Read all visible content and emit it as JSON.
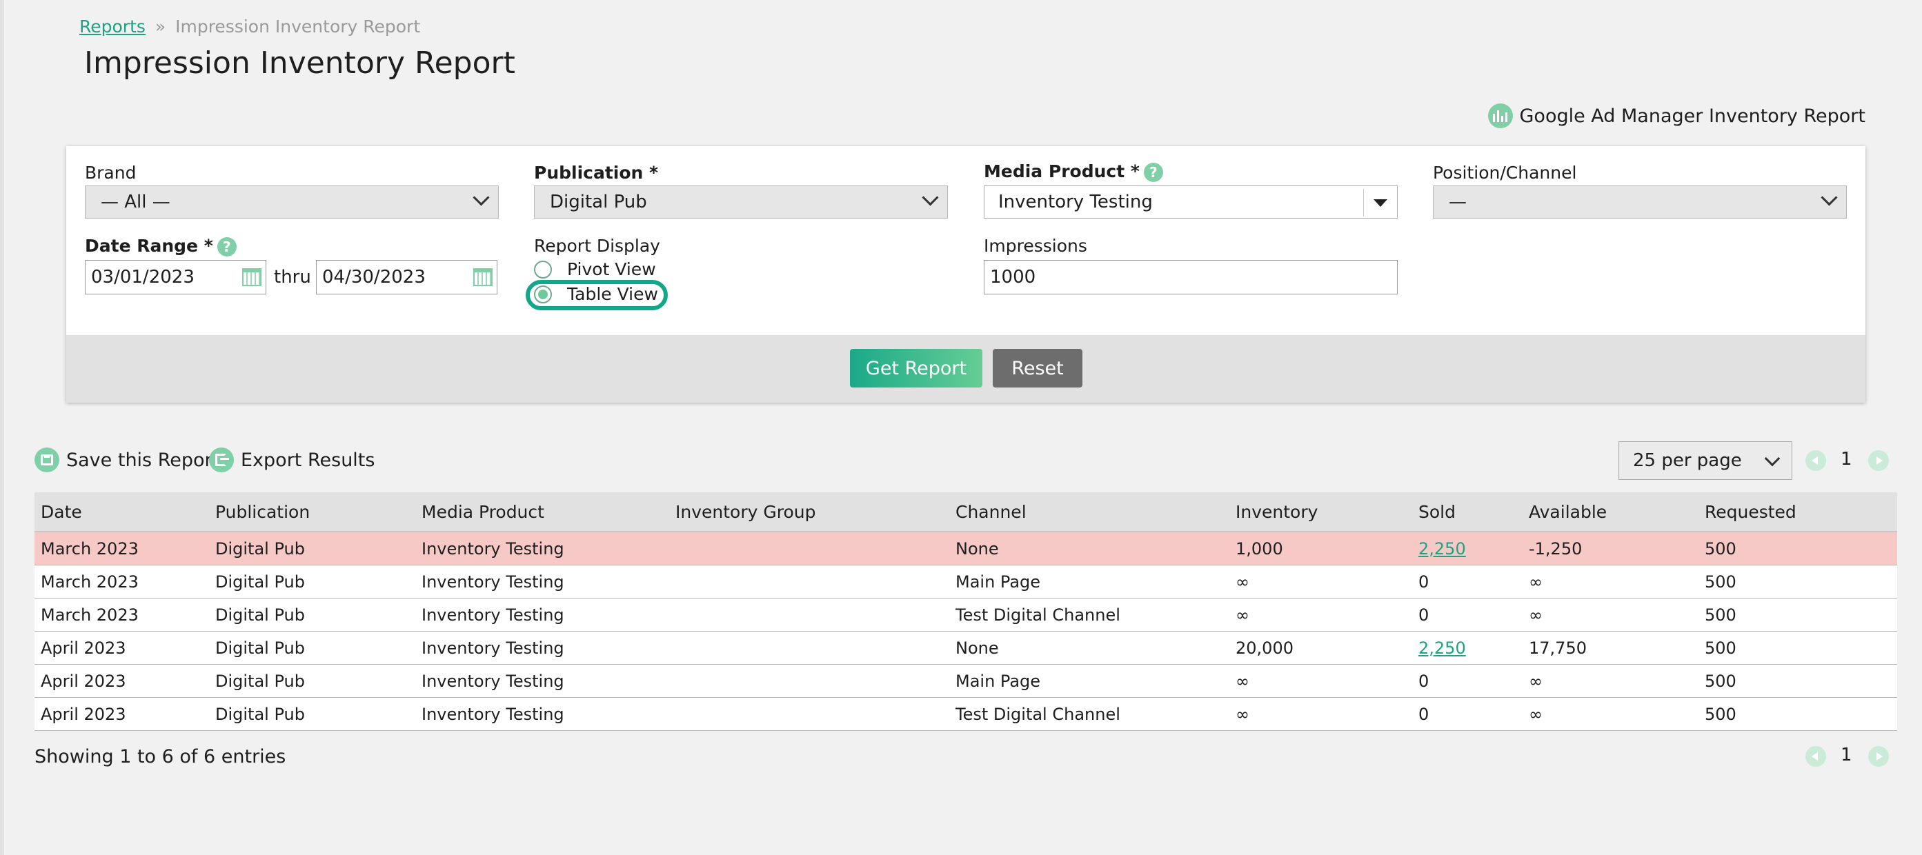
{
  "breadcrumb": {
    "parent": "Reports",
    "separator": "»",
    "current": "Impression Inventory Report"
  },
  "page_title": "Impression Inventory Report",
  "gam_link": {
    "label": "Google Ad Manager Inventory Report",
    "icon": "bar-chart-icon"
  },
  "filters": {
    "brand": {
      "label": "Brand",
      "value": "— All —"
    },
    "publication": {
      "label": "Publication *",
      "value": "Digital Pub"
    },
    "media_product": {
      "label": "Media Product *",
      "value": "Inventory Testing"
    },
    "position": {
      "label": "Position/Channel",
      "value": "—"
    },
    "date_range": {
      "label": "Date Range *",
      "start": "03/01/2023",
      "thru": "thru",
      "end": "04/30/2023"
    },
    "report_display": {
      "label": "Report Display",
      "options": [
        "Pivot View",
        "Table View"
      ],
      "selected": "Table View"
    },
    "impressions": {
      "label": "Impressions",
      "value": "1000"
    },
    "help": "?"
  },
  "buttons": {
    "get_report": "Get Report",
    "reset": "Reset"
  },
  "toolbar": {
    "save": "Save this Report",
    "export": "Export Results",
    "per_page": "25 per page",
    "page": "1"
  },
  "table": {
    "columns": [
      "Date",
      "Publication",
      "Media Product",
      "Inventory Group",
      "Channel",
      "Inventory",
      "Sold",
      "Available",
      "Requested"
    ],
    "rows": [
      {
        "date": "March 2023",
        "publication": "Digital Pub",
        "product": "Inventory Testing",
        "group": "",
        "channel": "None",
        "inventory": "1,000",
        "sold": "2,250",
        "sold_link": true,
        "available": "-1,250",
        "requested": "500",
        "alert": true
      },
      {
        "date": "March 2023",
        "publication": "Digital Pub",
        "product": "Inventory Testing",
        "group": "",
        "channel": "Main Page",
        "inventory": "∞",
        "sold": "0",
        "sold_link": false,
        "available": "∞",
        "requested": "500",
        "alert": false
      },
      {
        "date": "March 2023",
        "publication": "Digital Pub",
        "product": "Inventory Testing",
        "group": "",
        "channel": "Test Digital Channel",
        "inventory": "∞",
        "sold": "0",
        "sold_link": false,
        "available": "∞",
        "requested": "500",
        "alert": false
      },
      {
        "date": "April 2023",
        "publication": "Digital Pub",
        "product": "Inventory Testing",
        "group": "",
        "channel": "None",
        "inventory": "20,000",
        "sold": "2,250",
        "sold_link": true,
        "available": "17,750",
        "requested": "500",
        "alert": false
      },
      {
        "date": "April 2023",
        "publication": "Digital Pub",
        "product": "Inventory Testing",
        "group": "",
        "channel": "Main Page",
        "inventory": "∞",
        "sold": "0",
        "sold_link": false,
        "available": "∞",
        "requested": "500",
        "alert": false
      },
      {
        "date": "April 2023",
        "publication": "Digital Pub",
        "product": "Inventory Testing",
        "group": "",
        "channel": "Test Digital Channel",
        "inventory": "∞",
        "sold": "0",
        "sold_link": false,
        "available": "∞",
        "requested": "500",
        "alert": false
      }
    ]
  },
  "footer": {
    "showing": "Showing 1 to 6 of 6 entries",
    "page": "1"
  },
  "colors": {
    "accent": "#1fa184",
    "icon_green": "#7fcfa7",
    "alert_row": "#f6c9c7",
    "highlight": "#13a78a"
  }
}
